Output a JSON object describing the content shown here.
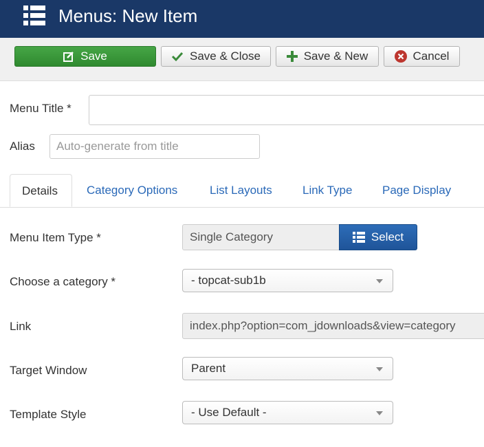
{
  "header": {
    "title": "Menus: New Item",
    "icon": "list-icon",
    "background": "#1a3867"
  },
  "toolbar": {
    "save_label": "Save",
    "save_close_label": "Save & Close",
    "save_new_label": "Save & New",
    "cancel_label": "Cancel",
    "save_color": "#3c9a3c"
  },
  "form": {
    "title_label": "Menu Title *",
    "title_value": "",
    "alias_label": "Alias",
    "alias_placeholder": "Auto-generate from title"
  },
  "tabs": [
    {
      "label": "Details",
      "active": true
    },
    {
      "label": "Category Options"
    },
    {
      "label": "List Layouts"
    },
    {
      "label": "Link Type"
    },
    {
      "label": "Page Display"
    }
  ],
  "details": {
    "menu_item_type_label": "Menu Item Type *",
    "menu_item_type_value": "Single Category",
    "select_label": "Select",
    "category_label": "Choose a category *",
    "category_value": "- topcat-sub1b",
    "link_label": "Link",
    "link_value": "index.php?option=com_jdownloads&view=category",
    "target_label": "Target Window",
    "target_value": "Parent",
    "template_label": "Template Style",
    "template_value": "- Use Default -"
  }
}
